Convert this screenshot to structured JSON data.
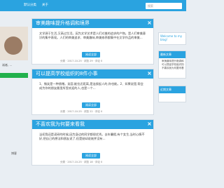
{
  "topbar": {
    "nav": [
      "默认分类",
      "关于"
    ],
    "search_placeholder": "搜索"
  },
  "left": {
    "img_caption": "诚者, ...",
    "label": "博客"
  },
  "cards": [
    {
      "title": "审美趣味提升格调和境界",
      "body": "文学源于生活,又高过生活。因为文学艺术是人们对美的追求的产物。是人们审美意识的集中表现。人们的审美追求、审美趣味,审美修养都集中在文学作品的审美...",
      "btn": "阅读全部",
      "meta": "分类  ·  2017-10-25  ·  浏览 29  ·  评论 0"
    },
    {
      "title": "可以提高学校组织的8件小事",
      "body": "1、微笑是一种馈赠。笑容,能拉近距离,是连接起人的,你也能。2、如果说是,帮会成为你的朋友圈里所受欢迎的人,也是一个...",
      "btn": "阅读全部",
      "meta": "分类  ·  2017-10-25  ·  浏览 22  ·  评论 0"
    },
    {
      "title": "不喜欢我为何要来看我",
      "body": "当初我还是读研的时候,因为身边的同学都很优秀。去年暑假,有个女生,当时心情不好,把自己的想法和朋友说了,但是她却说她并没有...",
      "btn": "阅读全部",
      "meta": "分类  ·  2017-10-25  ·  浏览 18  ·  评论 0"
    }
  ],
  "right": {
    "logo_text": "Welcome to my blog!",
    "widgets": [
      {
        "title": "最新文章",
        "items": [
          "审美趣味提升格调和境界",
          "可以提高学校组织的8件小事",
          "不喜欢我为何要来看我"
        ]
      },
      {
        "title": "近期文章",
        "items": []
      }
    ]
  }
}
